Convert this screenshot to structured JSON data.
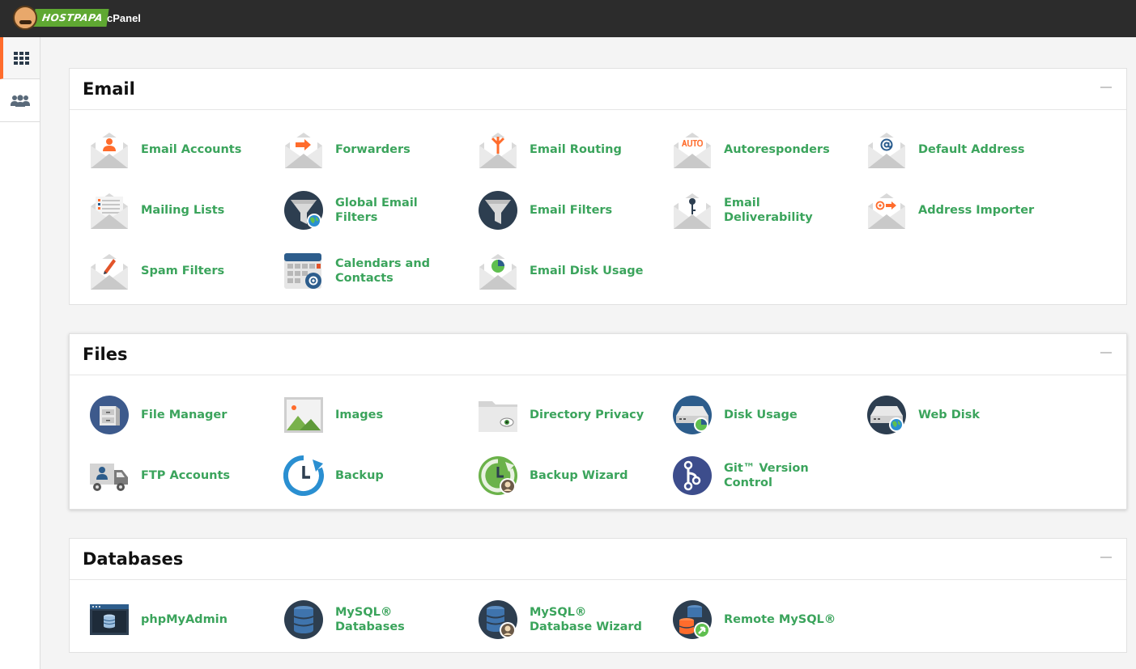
{
  "header": {
    "brand": "HOSTPAPA",
    "app_title": "cPanel"
  },
  "sidebar": {
    "items": [
      {
        "icon": "grid-icon"
      },
      {
        "icon": "users-icon"
      }
    ]
  },
  "colors": {
    "accent": "#ff6c2c",
    "link": "#3ba45c",
    "topbar": "#2c2c2c"
  },
  "sections": {
    "email": {
      "title": "Email",
      "items": [
        {
          "label": "Email Accounts",
          "icon": "email-accounts-icon"
        },
        {
          "label": "Forwarders",
          "icon": "forwarders-icon"
        },
        {
          "label": "Email Routing",
          "icon": "email-routing-icon"
        },
        {
          "label": "Autoresponders",
          "icon": "autoresponders-icon"
        },
        {
          "label": "Default Address",
          "icon": "default-address-icon"
        },
        {
          "label": "Mailing Lists",
          "icon": "mailing-lists-icon"
        },
        {
          "label": "Global Email Filters",
          "icon": "global-email-filters-icon"
        },
        {
          "label": "Email Filters",
          "icon": "email-filters-icon"
        },
        {
          "label": "Email Deliverability",
          "icon": "email-deliverability-icon"
        },
        {
          "label": "Address Importer",
          "icon": "address-importer-icon"
        },
        {
          "label": "Spam Filters",
          "icon": "spam-filters-icon"
        },
        {
          "label": "Calendars and Contacts",
          "icon": "calendar-icon"
        },
        {
          "label": "Email Disk Usage",
          "icon": "email-disk-usage-icon"
        }
      ]
    },
    "files": {
      "title": "Files",
      "items": [
        {
          "label": "File Manager",
          "icon": "file-manager-icon"
        },
        {
          "label": "Images",
          "icon": "images-icon"
        },
        {
          "label": "Directory Privacy",
          "icon": "directory-privacy-icon"
        },
        {
          "label": "Disk Usage",
          "icon": "disk-usage-icon"
        },
        {
          "label": "Web Disk",
          "icon": "web-disk-icon"
        },
        {
          "label": "FTP Accounts",
          "icon": "ftp-accounts-icon"
        },
        {
          "label": "Backup",
          "icon": "backup-icon"
        },
        {
          "label": "Backup Wizard",
          "icon": "backup-wizard-icon"
        },
        {
          "label": "Git™ Version Control",
          "icon": "git-icon"
        }
      ]
    },
    "databases": {
      "title": "Databases",
      "items": [
        {
          "label": "phpMyAdmin",
          "icon": "phpmyadmin-icon"
        },
        {
          "label": "MySQL® Databases",
          "icon": "mysql-databases-icon"
        },
        {
          "label": "MySQL® Database Wizard",
          "icon": "mysql-wizard-icon"
        },
        {
          "label": "Remote MySQL®",
          "icon": "remote-mysql-icon"
        }
      ]
    }
  }
}
